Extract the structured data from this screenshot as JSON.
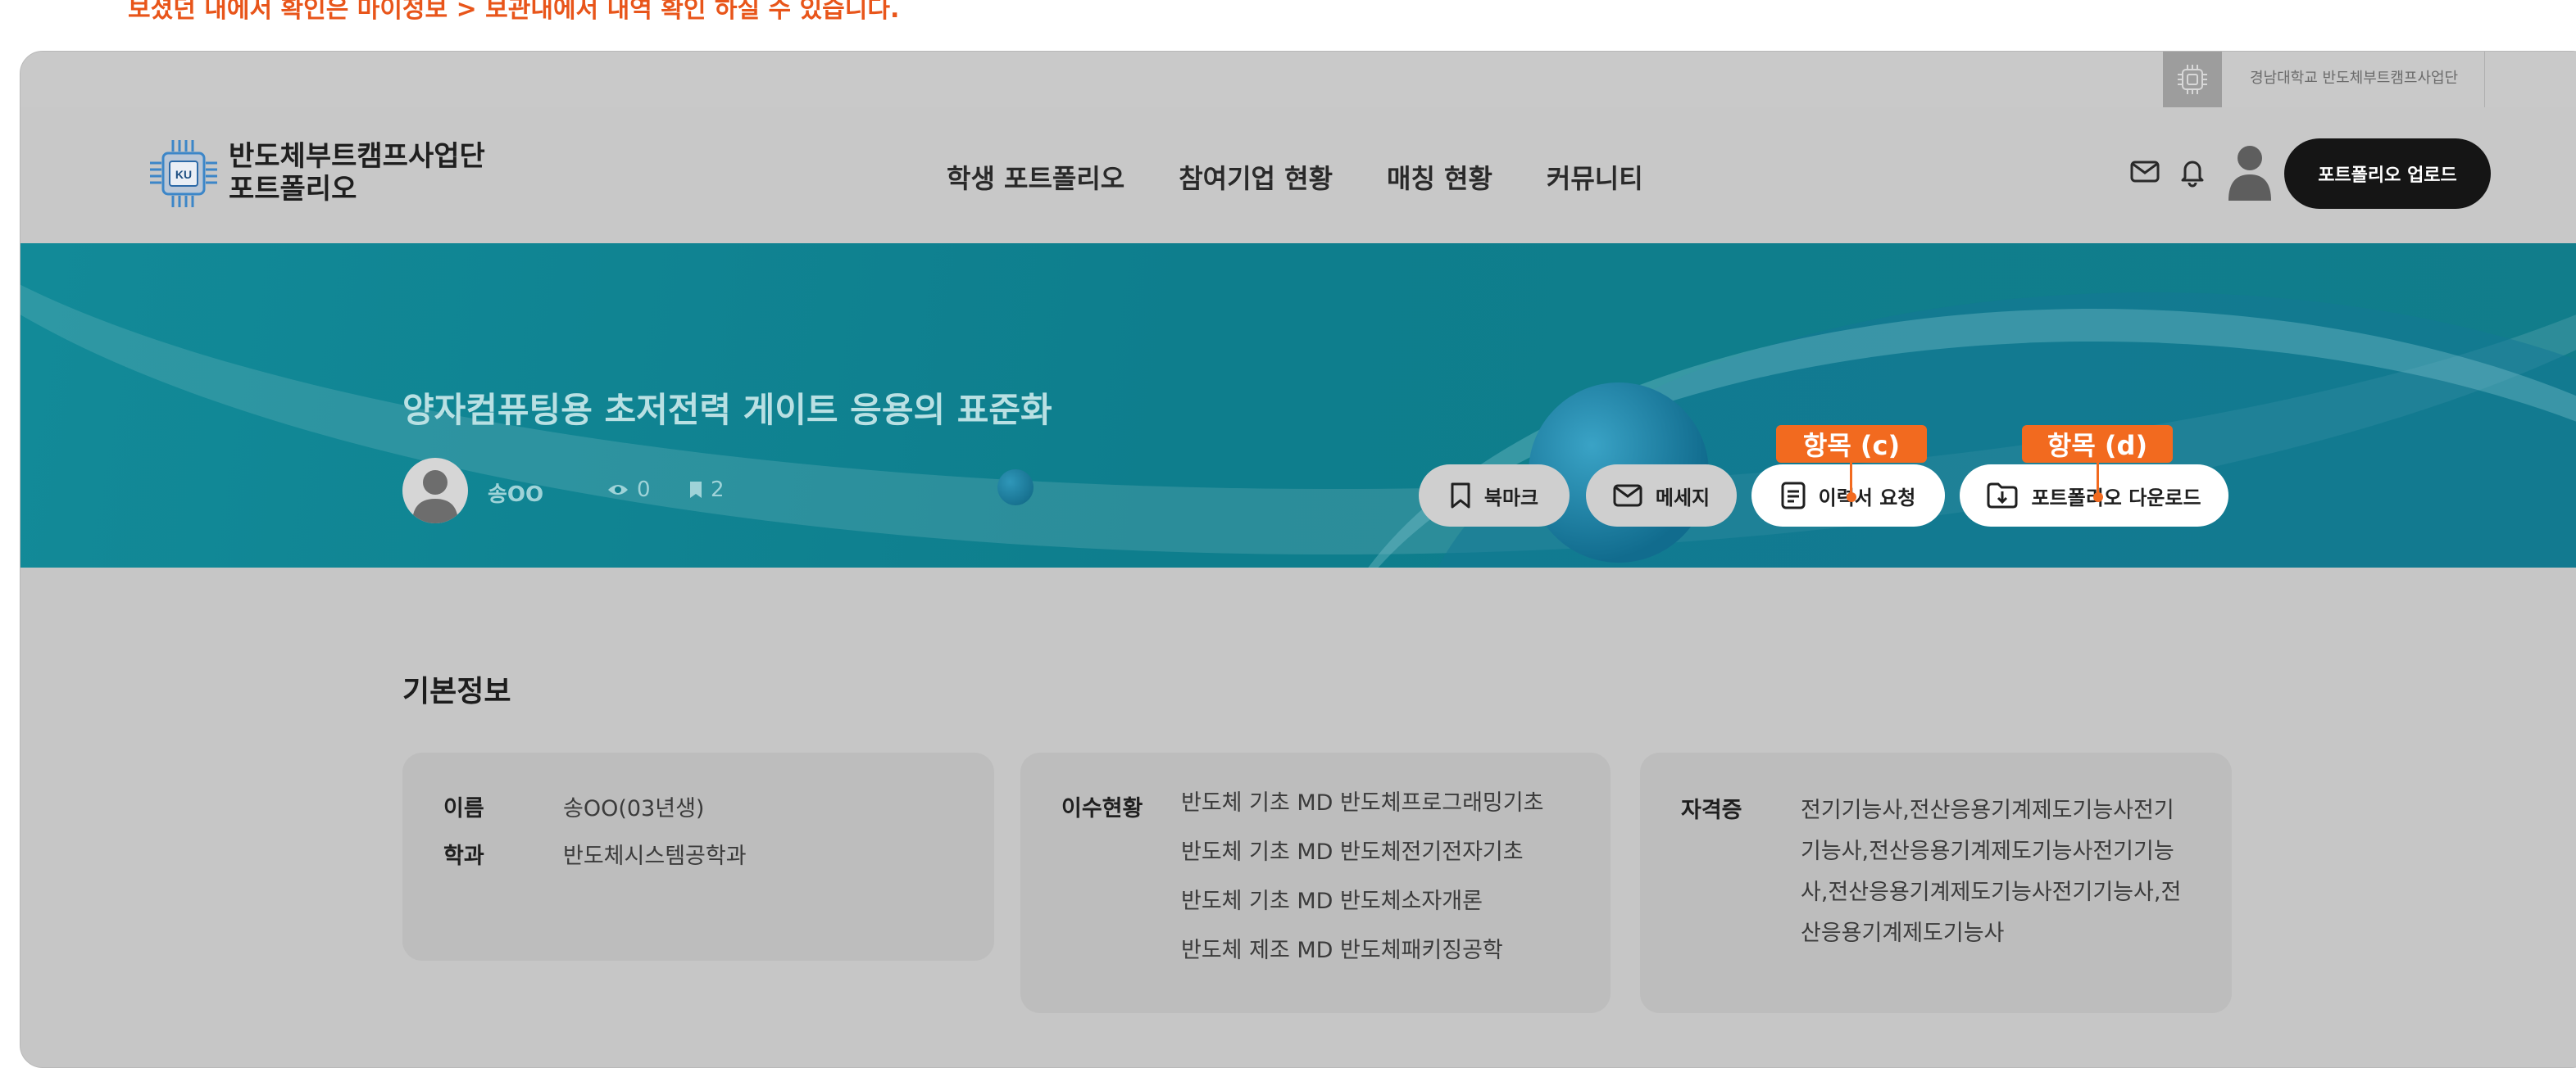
{
  "note": "보셨던 내에서 확인은 마이정보 > 보관내에서 내역 확인 하실 수 있습니다.",
  "util": {
    "org_name": "경남대학교 반도체부트캠프사업단"
  },
  "header": {
    "logo_title": "반도체부트캠프사업단",
    "logo_sub": "포트폴리오",
    "logo_mark": "KU",
    "nav": [
      "학생 포트폴리오",
      "참여기업 현황",
      "매칭 현황",
      "커뮤니티"
    ],
    "upload_label": "포트폴리오 업로드"
  },
  "banner": {
    "title": "양자컴퓨팅용 초저전력 게이트 응용의 표준화",
    "author": "송OO",
    "views": "0",
    "bookmarks": "2",
    "actions": {
      "bookmark": "북마크",
      "message": "메세지",
      "resume": "이력서 요청",
      "download": "포트폴리오 다운로드"
    },
    "callouts": {
      "c": "항목 (c)",
      "d": "항목 (d)"
    }
  },
  "basic": {
    "title": "기본정보",
    "name_label": "이름",
    "name_value": "송OO(03년생)",
    "dept_label": "학과",
    "dept_value": "반도체시스템공학과",
    "course_label": "이수현황",
    "courses": [
      "반도체 기초 MD 반도체프로그래밍기초",
      "반도체 기초 MD 반도체전기전자기초",
      "반도체 기초 MD 반도체소자개론",
      "반도체 제조 MD 반도체패키징공학"
    ],
    "cert_label": "자격증",
    "cert_value": "전기기능사,전산응용기계제도기능사전기기능사,전산응용기계제도기능사전기기능사,전산응용기계제도기능사전기기능사,전산응용기계제도기능사"
  }
}
